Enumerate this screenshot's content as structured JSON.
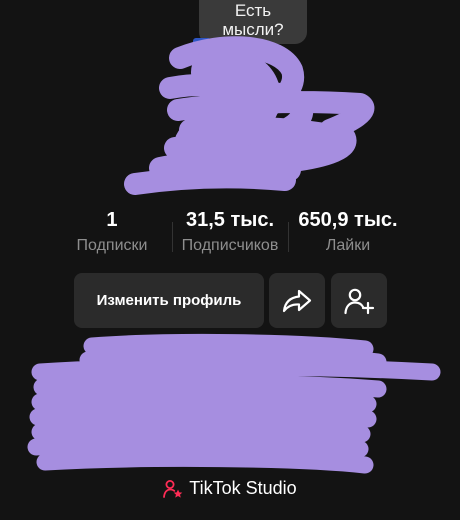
{
  "thought": {
    "line1": "Есть",
    "line2": "мысли?"
  },
  "stats": [
    {
      "value": "1",
      "label": "Подписки"
    },
    {
      "value": "31,5 тыс.",
      "label": "Подписчиков"
    },
    {
      "value": "650,9 тыс.",
      "label": "Лайки"
    }
  ],
  "actions": {
    "edit_profile": "Изменить профиль",
    "share_icon": "share-arrow-icon",
    "add_friend_icon": "add-person-icon"
  },
  "studio": {
    "label": "TikTok Studio",
    "icon": "person-star-icon",
    "icon_color": "#fe2c55"
  },
  "colors": {
    "background": "#131313",
    "button": "#2b2b2b",
    "redaction": "#a68ee0",
    "muted_text": "#8e8e8e"
  }
}
